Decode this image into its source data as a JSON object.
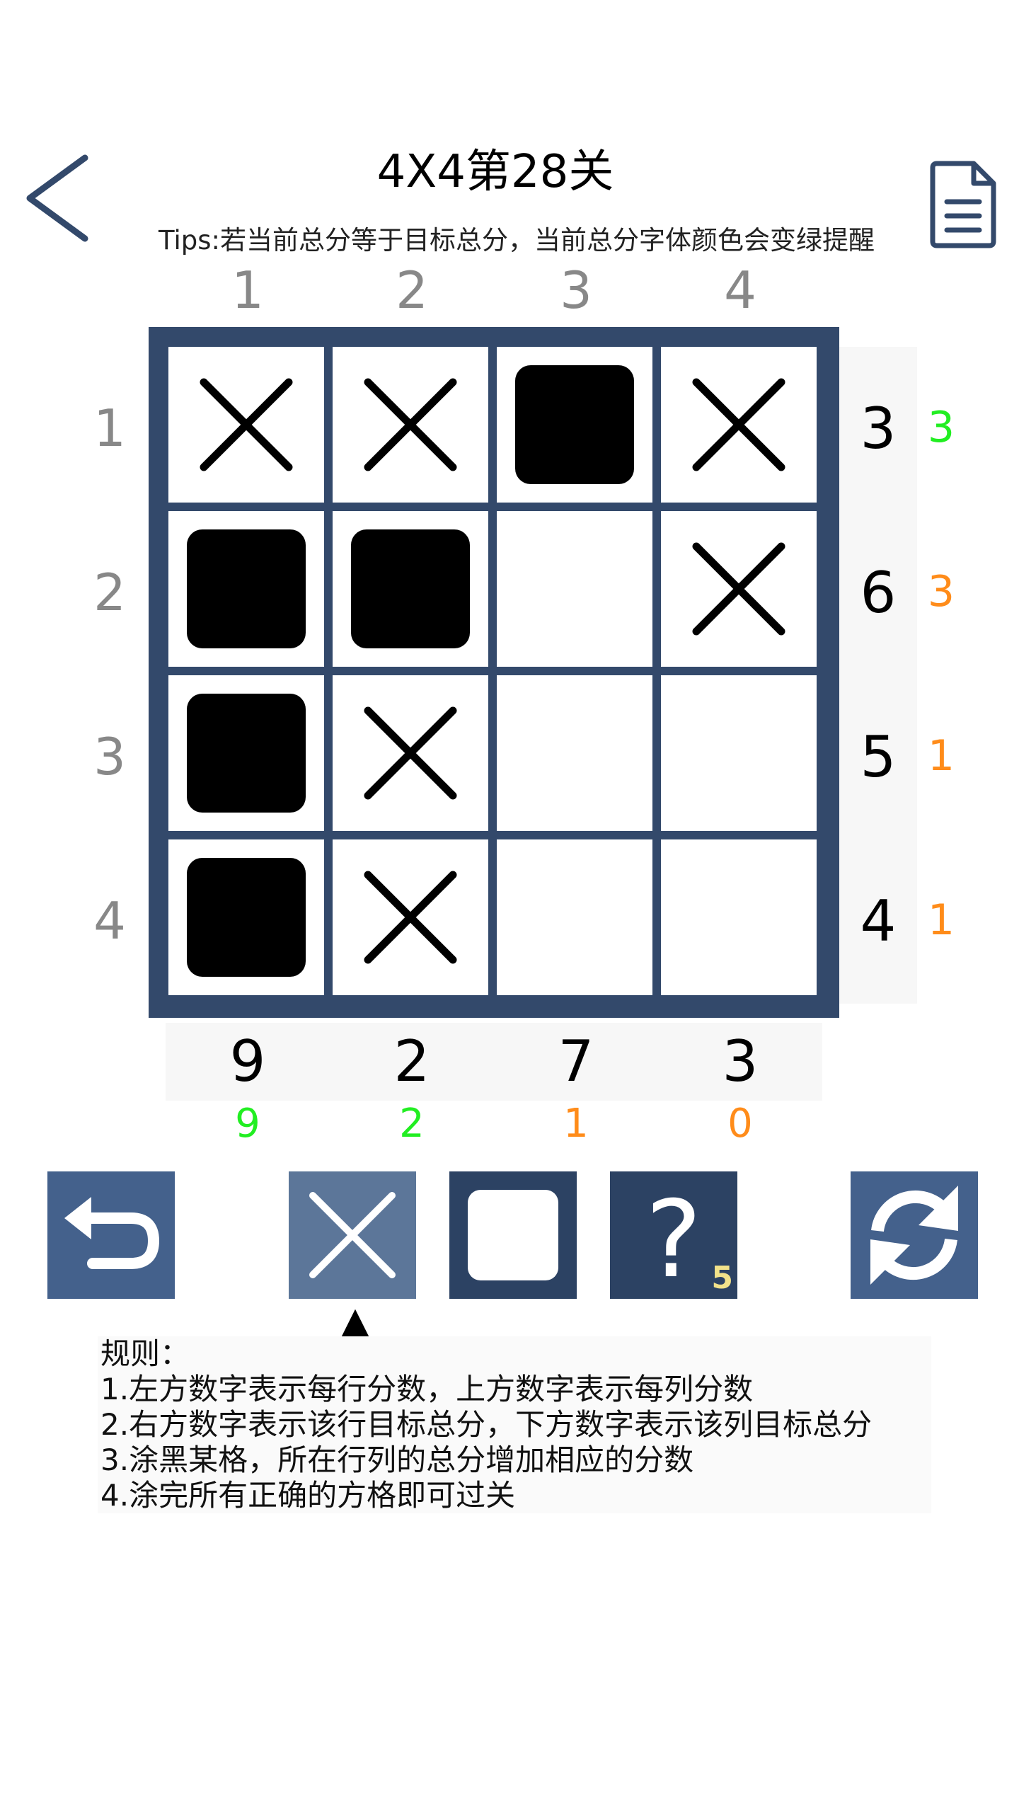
{
  "header": {
    "title": "4X4第28关",
    "tips": "Tips:若当前总分等于目标总分，当前总分字体颜色会变绿提醒"
  },
  "board": {
    "column_scores": [
      "1",
      "2",
      "3",
      "4"
    ],
    "row_scores": [
      "1",
      "2",
      "3",
      "4"
    ],
    "cells": [
      [
        "x",
        "x",
        "filled",
        "x"
      ],
      [
        "filled",
        "filled",
        "empty",
        "x"
      ],
      [
        "filled",
        "x",
        "empty",
        "empty"
      ],
      [
        "filled",
        "x",
        "empty",
        "empty"
      ]
    ],
    "row_targets": [
      "3",
      "6",
      "5",
      "4"
    ],
    "row_currents": [
      "3",
      "3",
      "1",
      "1"
    ],
    "column_targets": [
      "9",
      "2",
      "7",
      "3"
    ],
    "column_currents": [
      "9",
      "2",
      "1",
      "0"
    ]
  },
  "colors": {
    "board": "#33496b",
    "match": "#22ee22",
    "mismatch": "#ff8c1a",
    "tool_button": "#44618c",
    "tool_selected": "#5c7699",
    "tool_dark": "#2c4263"
  },
  "toolbar": {
    "undo_icon": "undo-icon",
    "mark_x_icon": "x-mark-icon",
    "fill_icon": "square-icon",
    "hint_icon": "question-icon",
    "hint_count": "5",
    "reset_icon": "refresh-icon",
    "selected_tool": "mark-x",
    "selector_glyph": "▲"
  },
  "rules": [
    "规则：",
    "1.左方数字表示每行分数，上方数字表示每列分数",
    "2.右方数字表示该行目标总分，下方数字表示该列目标总分",
    "3.涂黑某格，所在行列的总分增加相应的分数",
    "4.涂完所有正确的方格即可过关"
  ]
}
